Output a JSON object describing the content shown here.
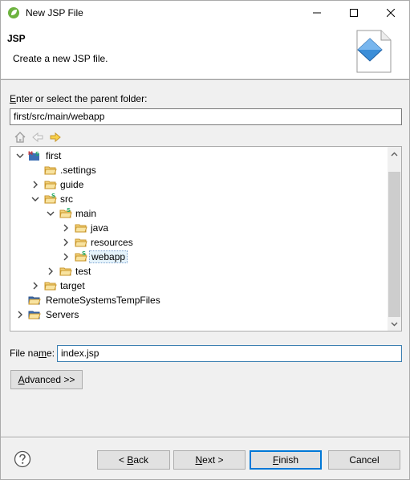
{
  "window": {
    "title": "New JSP File"
  },
  "banner": {
    "title": "JSP",
    "description": "Create a new JSP file."
  },
  "parent_folder": {
    "label_prefix": "E",
    "label_rest": "nter or select the parent folder:",
    "value": "first/src/main/webapp"
  },
  "tree": {
    "items": [
      {
        "label": "first"
      },
      {
        "label": ".settings"
      },
      {
        "label": "guide"
      },
      {
        "label": "src"
      },
      {
        "label": "main"
      },
      {
        "label": "java"
      },
      {
        "label": "resources"
      },
      {
        "label": "webapp"
      },
      {
        "label": "test"
      },
      {
        "label": "target"
      },
      {
        "label": "RemoteSystemsTempFiles"
      },
      {
        "label": "Servers"
      }
    ]
  },
  "file_name": {
    "label_prefix": "File na",
    "label_underline": "m",
    "label_rest": "e:",
    "value": "index.jsp"
  },
  "buttons": {
    "advanced_prefix": "A",
    "advanced_rest": "dvanced >>",
    "back_prefix": "< ",
    "back_underline": "B",
    "back_rest": "ack",
    "next_underline": "N",
    "next_rest": "ext >",
    "finish_underline": "F",
    "finish_rest": "inish",
    "cancel": "Cancel"
  },
  "colors": {
    "folder": "#e8b53a",
    "accent": "#0078d7",
    "selection": "#e5f3fb"
  }
}
